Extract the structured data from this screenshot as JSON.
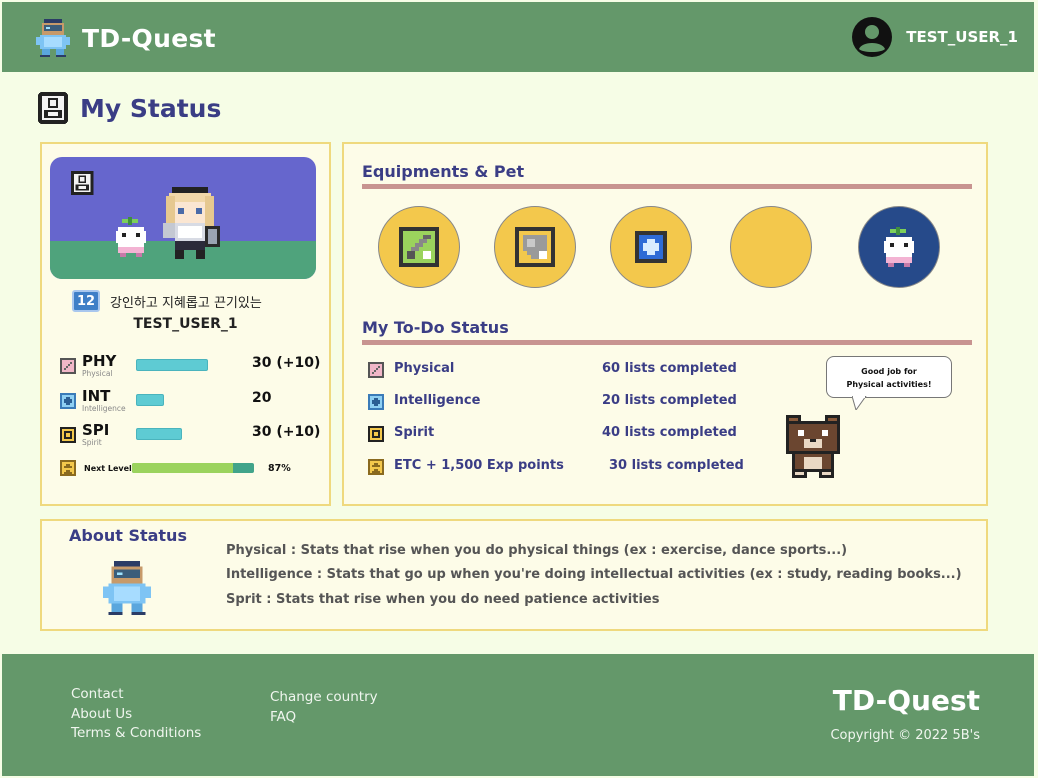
{
  "header": {
    "app_name": "TD-Quest",
    "username": "TEST_USER_1",
    "logo_icon": "pixel-robot-icon",
    "avatar_icon": "user-avatar-icon",
    "bg_color": "#64986a"
  },
  "page": {
    "title": "My Status",
    "title_icon": "status-badge-icon"
  },
  "character": {
    "level": "12",
    "title_text": "강인하고 지혜롭고 끈기있는",
    "name": "TEST_USER_1",
    "sky_color": "#6666cd",
    "ground_color": "#4fa37c",
    "stats": [
      {
        "abbr": "PHY",
        "full": "Physical",
        "value": "30 (+10)",
        "bar_level": 0.55,
        "icon": "physical-icon"
      },
      {
        "abbr": "INT",
        "full": "Intelligence",
        "value": "20",
        "bar_level": 0.21,
        "icon": "intelligence-icon"
      },
      {
        "abbr": "SPI",
        "full": "Spirit",
        "value": "30 (+10)",
        "bar_level": 0.36,
        "icon": "spirit-icon"
      }
    ],
    "next_level": {
      "label": "Next Level",
      "percent_text": "87%",
      "percent": 87,
      "icon": "next-level-icon"
    }
  },
  "equipment": {
    "title": "Equipments & Pet",
    "slots": [
      {
        "icon": "sword-icon",
        "kind": "weapon"
      },
      {
        "icon": "shield-icon",
        "kind": "armor"
      },
      {
        "icon": "crystal-icon",
        "kind": "accessory"
      },
      {
        "icon": "empty-slot-icon",
        "kind": "empty"
      },
      {
        "icon": "sprout-pet-icon",
        "kind": "pet"
      }
    ]
  },
  "todo": {
    "title": "My To-Do Status",
    "rows": [
      {
        "label": "Physical",
        "count": "60 lists completed",
        "icon": "physical-icon"
      },
      {
        "label": "Intelligence",
        "count": "20 lists completed",
        "icon": "intelligence-icon"
      },
      {
        "label": "Spirit",
        "count": "40 lists completed",
        "icon": "spirit-icon"
      },
      {
        "label": "ETC + 1,500 Exp points",
        "count": "30 lists completed",
        "icon": "etc-icon"
      }
    ],
    "speech_line1": "Good job for",
    "speech_line2": "Physical activities!"
  },
  "about": {
    "title": "About Status",
    "lines": [
      "Physical : Stats that rise when you do physical things (ex : exercise, dance sports...)",
      "Intelligence : Stats that go up when you're doing intellectual activities (ex : study, reading books...)",
      "Sprit : Stats that rise when you do need patience activities"
    ]
  },
  "footer": {
    "links_col1": [
      "Contact",
      "About Us",
      "Terms & Conditions"
    ],
    "links_col2": [
      "Change country",
      "FAQ"
    ],
    "brand": "TD-Quest",
    "copyright": "Copyright © 2022 5B's"
  }
}
